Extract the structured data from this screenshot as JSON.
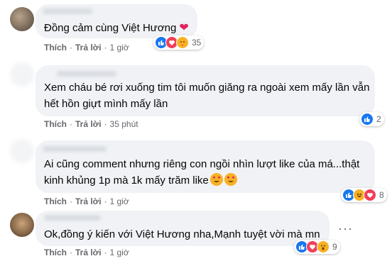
{
  "comments": [
    {
      "text": "Đồng cảm cùng Việt Hương",
      "emoji": "heart",
      "actions": {
        "like": "Thích",
        "reply": "Trả lời",
        "time": "1 giờ"
      },
      "reaction_count": "35"
    },
    {
      "text_line1": "Xem cháu bé rơi xuống tim tôi muốn giăng ra ngoài xem mấy lần vẫn",
      "text_line2": "hết hồn giựt mình mấy lần",
      "actions": {
        "like": "Thích",
        "reply": "Trả lời",
        "time": "35 phút"
      },
      "reaction_count": "2"
    },
    {
      "text_line1": "Ai cũng comment nhưng riêng con ngồi nhìn lượt like của má...thật",
      "text_line2": "kinh khủng 1p mà 1k mấy trăm like",
      "actions": {
        "like": "Thích",
        "reply": "Trả lời",
        "time": "1 giờ"
      },
      "reaction_count": "8"
    },
    {
      "text": "Ok,đồng ý kiến với Việt Hương nha,Mạnh tuyệt vời mà mn",
      "actions": {
        "like": "Thích",
        "reply": "Trả lời",
        "time": "1 giờ"
      },
      "reaction_count": "9"
    }
  ],
  "more_options": "···",
  "separator": "·"
}
